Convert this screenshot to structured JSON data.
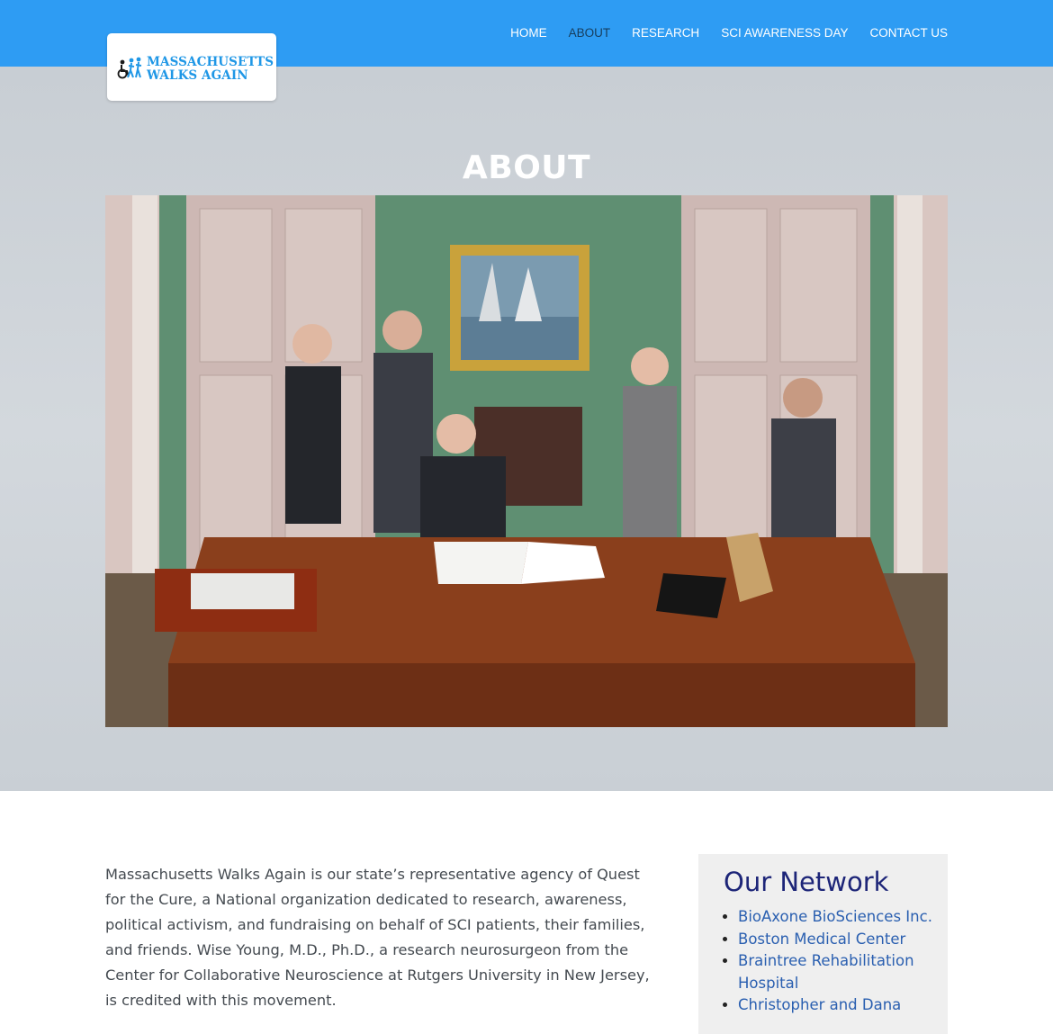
{
  "brand": {
    "line1": "MASSACHUSETTS",
    "line2": "WALKS AGAIN",
    "icon": "wheelchair-walking-figures-icon",
    "color": "#1f97e6"
  },
  "nav": {
    "items": [
      {
        "label": "HOME",
        "active": false
      },
      {
        "label": "ABOUT",
        "active": true
      },
      {
        "label": "RESEARCH",
        "active": false
      },
      {
        "label": "SCI AWARENESS DAY",
        "active": false
      },
      {
        "label": "CONTACT US",
        "active": false
      }
    ]
  },
  "hero": {
    "title": "ABOUT"
  },
  "content": {
    "paragraph": "Massachusetts Walks Again is our state’s representative agency of Quest for the Cure, a National organization dedicated to research, awareness, political activism, and fundraising on behalf of SCI patients, their families, and friends. Wise Young, M.D., Ph.D., a research neurosurgeon from the Center for Collaborative Neuroscience at Rutgers University in New Jersey, is credited with this movement."
  },
  "sidebar": {
    "title": "Our Network",
    "links": [
      "BioAxone BioSciences Inc.",
      "Boston Medical Center",
      "Braintree Rehabilitation Hospital",
      "Christopher and Dana"
    ]
  },
  "colors": {
    "topbar": "#2e9cf3",
    "nav_active": "#173d5c",
    "sidebar_title": "#1d2578",
    "link": "#2a5fb0"
  }
}
